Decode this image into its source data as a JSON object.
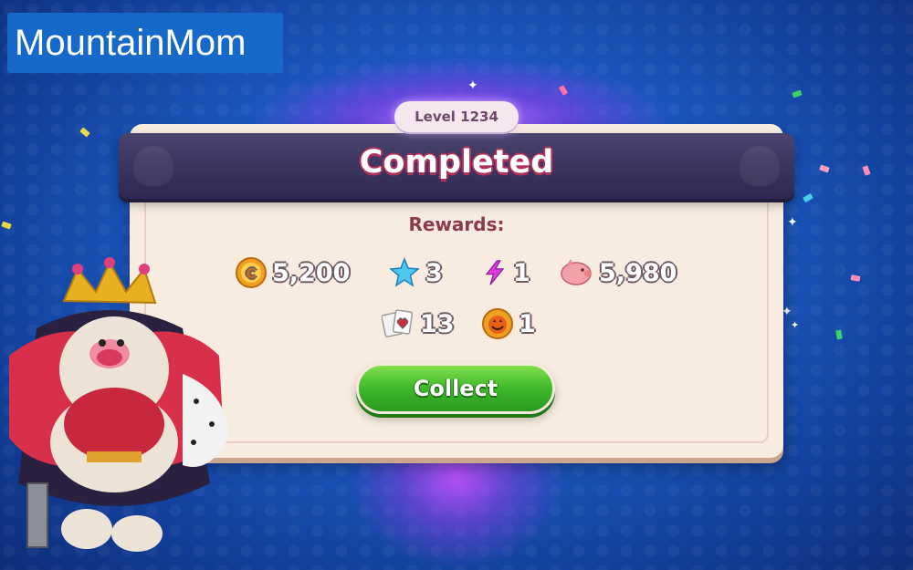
{
  "watermark": "MountainMom",
  "level_label": "Level 1234",
  "title": "Completed",
  "rewards_label": "Rewards:",
  "rewards_row1": [
    {
      "icon": "gold-coin-icon",
      "value": "5,200"
    },
    {
      "icon": "star-icon",
      "value": "3"
    },
    {
      "icon": "lightning-icon",
      "value": "1"
    },
    {
      "icon": "piggy-bank-icon",
      "value": "5,980"
    }
  ],
  "rewards_row2": [
    {
      "icon": "cards-icon",
      "value": "13"
    },
    {
      "icon": "pumpkin-coin-icon",
      "value": "1"
    }
  ],
  "collect_label": "Collect",
  "colors": {
    "background": "#1c5bc4",
    "panel": "#f8ece0",
    "banner": "#3c3560",
    "button_green": "#3fb82a",
    "rewards_text": "#8b3a4a"
  }
}
